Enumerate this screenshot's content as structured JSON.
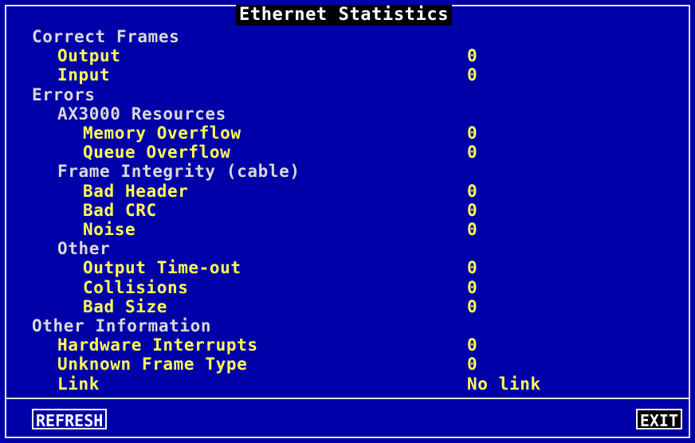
{
  "window": {
    "title": "Ethernet Statistics"
  },
  "sections": [
    {
      "label": "Correct Frames",
      "level": 0,
      "value": "",
      "kind": "section"
    },
    {
      "label": "Output",
      "level": 1,
      "value": "0",
      "kind": "item"
    },
    {
      "label": "Input",
      "level": 1,
      "value": "0",
      "kind": "item"
    },
    {
      "label": "Errors",
      "level": 0,
      "value": "",
      "kind": "section"
    },
    {
      "label": "AX3000 Resources",
      "level": 1,
      "value": "",
      "kind": "section"
    },
    {
      "label": "Memory Overflow",
      "level": 2,
      "value": "0",
      "kind": "item"
    },
    {
      "label": "Queue Overflow",
      "level": 2,
      "value": "0",
      "kind": "item"
    },
    {
      "label": "Frame Integrity (cable)",
      "level": 1,
      "value": "",
      "kind": "section"
    },
    {
      "label": "Bad Header",
      "level": 2,
      "value": "0",
      "kind": "item"
    },
    {
      "label": "Bad CRC",
      "level": 2,
      "value": "0",
      "kind": "item"
    },
    {
      "label": "Noise",
      "level": 2,
      "value": "0",
      "kind": "item"
    },
    {
      "label": "Other",
      "level": 1,
      "value": "",
      "kind": "section"
    },
    {
      "label": "Output Time-out",
      "level": 2,
      "value": "0",
      "kind": "item"
    },
    {
      "label": "Collisions",
      "level": 2,
      "value": "0",
      "kind": "item"
    },
    {
      "label": "Bad Size",
      "level": 2,
      "value": "0",
      "kind": "item"
    },
    {
      "label": "Other Information",
      "level": 0,
      "value": "",
      "kind": "section"
    },
    {
      "label": "Hardware Interrupts",
      "level": 1,
      "value": "0",
      "kind": "item"
    },
    {
      "label": "Unknown Frame Type",
      "level": 1,
      "value": "0",
      "kind": "item"
    },
    {
      "label": "Link",
      "level": 1,
      "value": "No link",
      "kind": "item"
    }
  ],
  "buttons": {
    "refresh": "REFRESH",
    "exit": "EXIT"
  },
  "colors": {
    "background": "#0000a8",
    "item_text": "#ffff55",
    "section_text": "#d9d9d9",
    "title_bg": "#000000"
  }
}
